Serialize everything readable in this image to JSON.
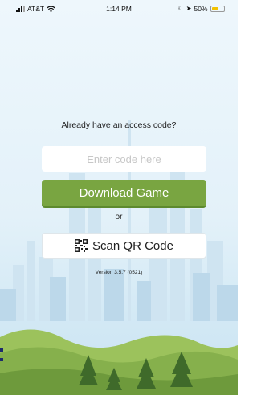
{
  "status_bar": {
    "carrier": "AT&T",
    "time": "1:14 PM",
    "battery": "50%"
  },
  "prompt": "Already have an access code?",
  "code_input": {
    "placeholder": "Enter code here",
    "value": ""
  },
  "download_button": "Download Game",
  "or_text": "or",
  "scan_button": {
    "label": "Scan QR Code",
    "icon": "qr-code-icon"
  },
  "version": "Version 3.5.7 (0521)",
  "colors": {
    "primary": "#79a541",
    "sky": "#e3f1f9",
    "hill": "#86b04c",
    "tree": "#3f6a2a"
  }
}
